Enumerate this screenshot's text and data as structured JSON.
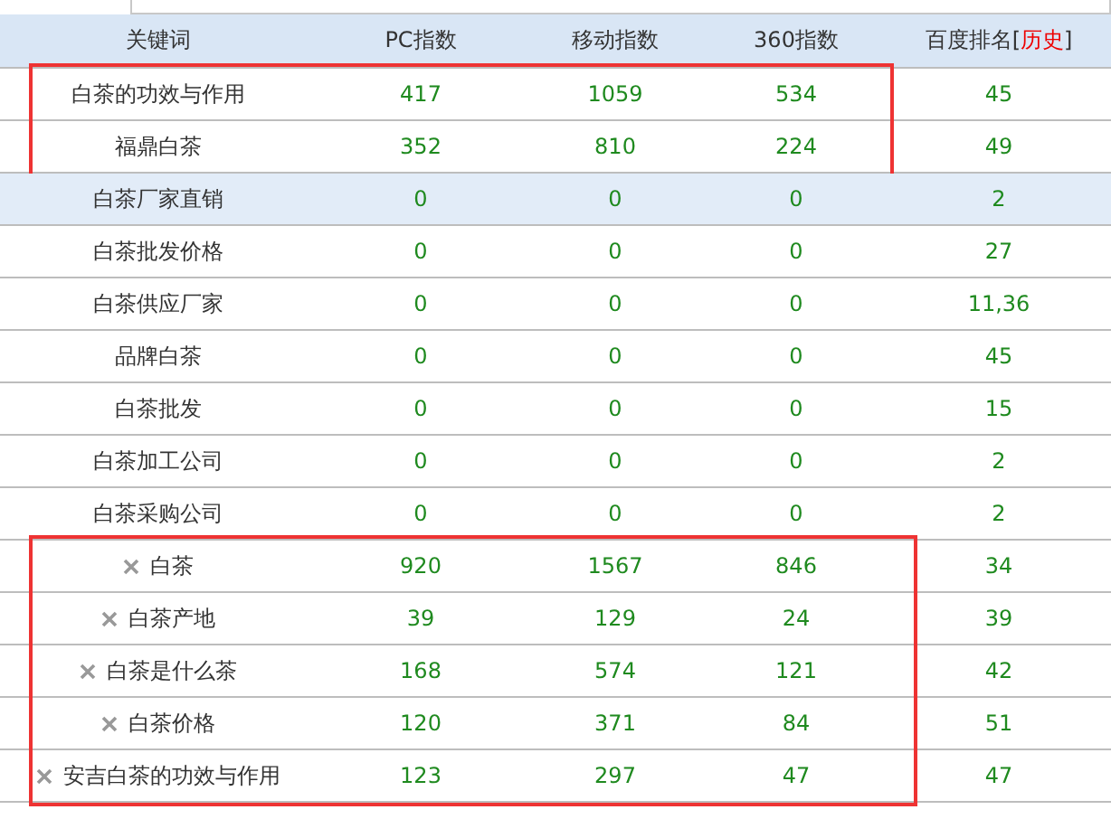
{
  "columns": [
    {
      "label": "关键词"
    },
    {
      "label": "PC指数"
    },
    {
      "label": "移动指数"
    },
    {
      "label": "360指数"
    },
    {
      "label": "百度排名[",
      "link": "历史",
      "suffix": "]"
    }
  ],
  "row_groups": [
    {
      "kind": "boxed",
      "rows": [
        {
          "keyword": "白茶的功效与作用",
          "removable": false,
          "selected": false,
          "pc": "417",
          "mobile": "1059",
          "s360": "534",
          "rank": "45"
        },
        {
          "keyword": "福鼎白茶",
          "removable": false,
          "selected": false,
          "pc": "352",
          "mobile": "810",
          "s360": "224",
          "rank": "49"
        }
      ]
    },
    {
      "kind": "plain",
      "rows": [
        {
          "keyword": "白茶厂家直销",
          "removable": false,
          "selected": true,
          "pc": "0",
          "mobile": "0",
          "s360": "0",
          "rank": "2"
        },
        {
          "keyword": "白茶批发价格",
          "removable": false,
          "selected": false,
          "pc": "0",
          "mobile": "0",
          "s360": "0",
          "rank": "27"
        },
        {
          "keyword": "白茶供应厂家",
          "removable": false,
          "selected": false,
          "pc": "0",
          "mobile": "0",
          "s360": "0",
          "rank": "11,36"
        },
        {
          "keyword": "品牌白茶",
          "removable": false,
          "selected": false,
          "pc": "0",
          "mobile": "0",
          "s360": "0",
          "rank": "45"
        },
        {
          "keyword": "白茶批发",
          "removable": false,
          "selected": false,
          "pc": "0",
          "mobile": "0",
          "s360": "0",
          "rank": "15"
        },
        {
          "keyword": "白茶加工公司",
          "removable": false,
          "selected": false,
          "pc": "0",
          "mobile": "0",
          "s360": "0",
          "rank": "2"
        },
        {
          "keyword": "白茶采购公司",
          "removable": false,
          "selected": false,
          "pc": "0",
          "mobile": "0",
          "s360": "0",
          "rank": "2"
        }
      ]
    },
    {
      "kind": "boxed",
      "rows": [
        {
          "keyword": "白茶",
          "removable": true,
          "selected": false,
          "pc": "920",
          "mobile": "1567",
          "s360": "846",
          "rank": "34"
        },
        {
          "keyword": "白茶产地",
          "removable": true,
          "selected": false,
          "pc": "39",
          "mobile": "129",
          "s360": "24",
          "rank": "39"
        },
        {
          "keyword": "白茶是什么茶",
          "removable": true,
          "selected": false,
          "pc": "168",
          "mobile": "574",
          "s360": "121",
          "rank": "42"
        },
        {
          "keyword": "白茶价格",
          "removable": true,
          "selected": false,
          "pc": "120",
          "mobile": "371",
          "s360": "84",
          "rank": "51"
        },
        {
          "keyword": "安吉白茶的功效与作用",
          "removable": true,
          "selected": false,
          "pc": "123",
          "mobile": "297",
          "s360": "47",
          "rank": "47"
        }
      ]
    }
  ]
}
